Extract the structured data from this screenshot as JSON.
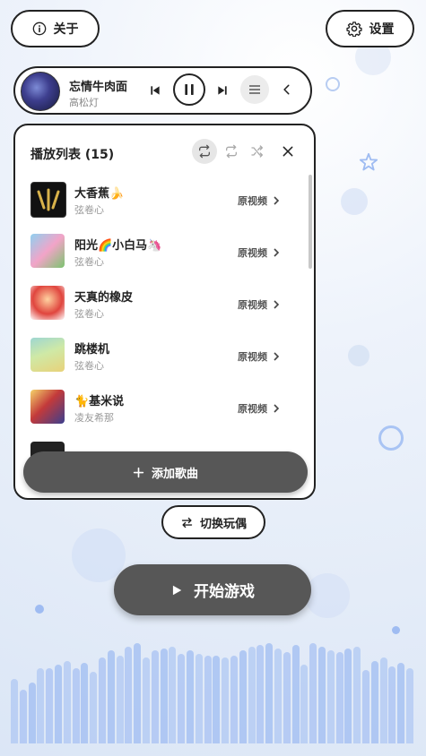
{
  "header": {
    "about_label": "关于",
    "settings_label": "设置"
  },
  "player": {
    "title": "忘情牛肉面",
    "artist": "高松灯"
  },
  "playlist": {
    "title": "播放列表 (15)",
    "items": [
      {
        "title": "大香蕉🍌",
        "artist": "弦卷心",
        "link": "原视频"
      },
      {
        "title": "阳光🌈小白马🦄",
        "artist": "弦卷心",
        "link": "原视频"
      },
      {
        "title": "天真的橡皮",
        "artist": "弦卷心",
        "link": "原视频"
      },
      {
        "title": "跳楼机",
        "artist": "弦卷心",
        "link": "原视频"
      },
      {
        "title": "🐈基米说",
        "artist": "凌友希那",
        "link": "原视频"
      }
    ],
    "add_label": "添加歌曲"
  },
  "switch_label": "切换玩偶",
  "start_label": "开始游戏",
  "colors": {
    "accent_dark": "#575757",
    "visualizer": "#9fbcf2"
  }
}
